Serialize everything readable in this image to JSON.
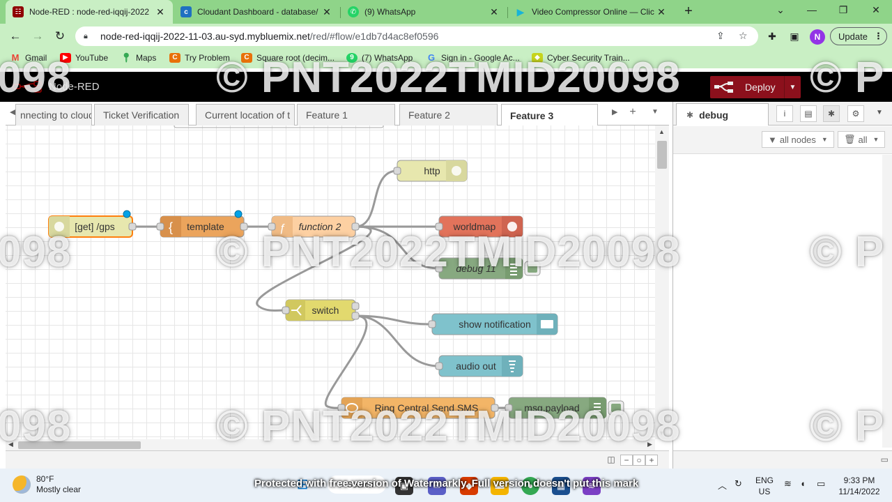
{
  "browser": {
    "tabs": [
      {
        "title": "Node-RED : node-red-iqqij-2022",
        "icon": "node-red-favicon",
        "color": "#8f0000"
      },
      {
        "title": "Cloudant Dashboard - database/",
        "icon": "cloudant-favicon",
        "color": "#1f70c1"
      },
      {
        "title": "(9) WhatsApp",
        "icon": "whatsapp-favicon",
        "color": "#25d366"
      },
      {
        "title": "Video Compressor Online — Clic",
        "icon": "play-favicon",
        "color": "#18b4d8"
      }
    ],
    "url": {
      "domain": "node-red-iqqij-2022-11-03.au-syd.mybluemix.net",
      "path": "/red/#flow/e1db7d4ac8ef0596"
    },
    "profile_initial": "N",
    "update_label": "Update",
    "bookmarks": [
      {
        "label": "Gmail",
        "icon": "gmail-icon",
        "color": "#ea4335"
      },
      {
        "label": "YouTube",
        "icon": "youtube-icon",
        "color": "#ff0000"
      },
      {
        "label": "Maps",
        "icon": "maps-pin-icon",
        "color": "#34a853"
      },
      {
        "label": "Try Problem",
        "icon": "codechef-icon",
        "color": "#e8710a"
      },
      {
        "label": "Square root (decim...",
        "icon": "codechef-icon",
        "color": "#e8710a"
      },
      {
        "label": "(7) WhatsApp",
        "icon": "whatsapp-icon",
        "color": "#25d366"
      },
      {
        "label": "Sign in - Google Ac...",
        "icon": "google-icon",
        "color": "#4285f4"
      },
      {
        "label": "Cyber Security Train...",
        "icon": "shield-icon",
        "color": "#c6d41c"
      }
    ]
  },
  "nodered": {
    "app_name": "Node-RED",
    "deploy_label": "Deploy",
    "workspace_tabs": [
      "nnecting to cloud",
      "Ticket Verification",
      "Current location of t",
      "Feature 1",
      "Feature 2",
      "Feature 3"
    ],
    "active_tab": "Feature 3",
    "nodes": {
      "http_in": "[get] /gps",
      "template": "template",
      "function": "function 2",
      "http_response": "http",
      "worldmap": "worldmap",
      "debug11": "debug 11",
      "switch": "switch",
      "notify": "show notification",
      "audio": "audio out",
      "sms": "Ring Central Send SMS",
      "payload": "msg.payload"
    },
    "sidebar": {
      "tab_label": "debug",
      "filter_label": "all nodes",
      "clear_label": "all"
    }
  },
  "watermark": {
    "text": "© PNT2022TMID20098",
    "partial_left": "098",
    "partial_right": "© P"
  },
  "taskbar": {
    "temp": "80°F",
    "condition": "Mostly clear",
    "notice": "Protected with free version of Watermarkly. Full version doesn't put this mark",
    "search_label": "Search",
    "lang": "ENG",
    "region": "US",
    "time": "9:33 PM",
    "date": "11/14/2022"
  }
}
